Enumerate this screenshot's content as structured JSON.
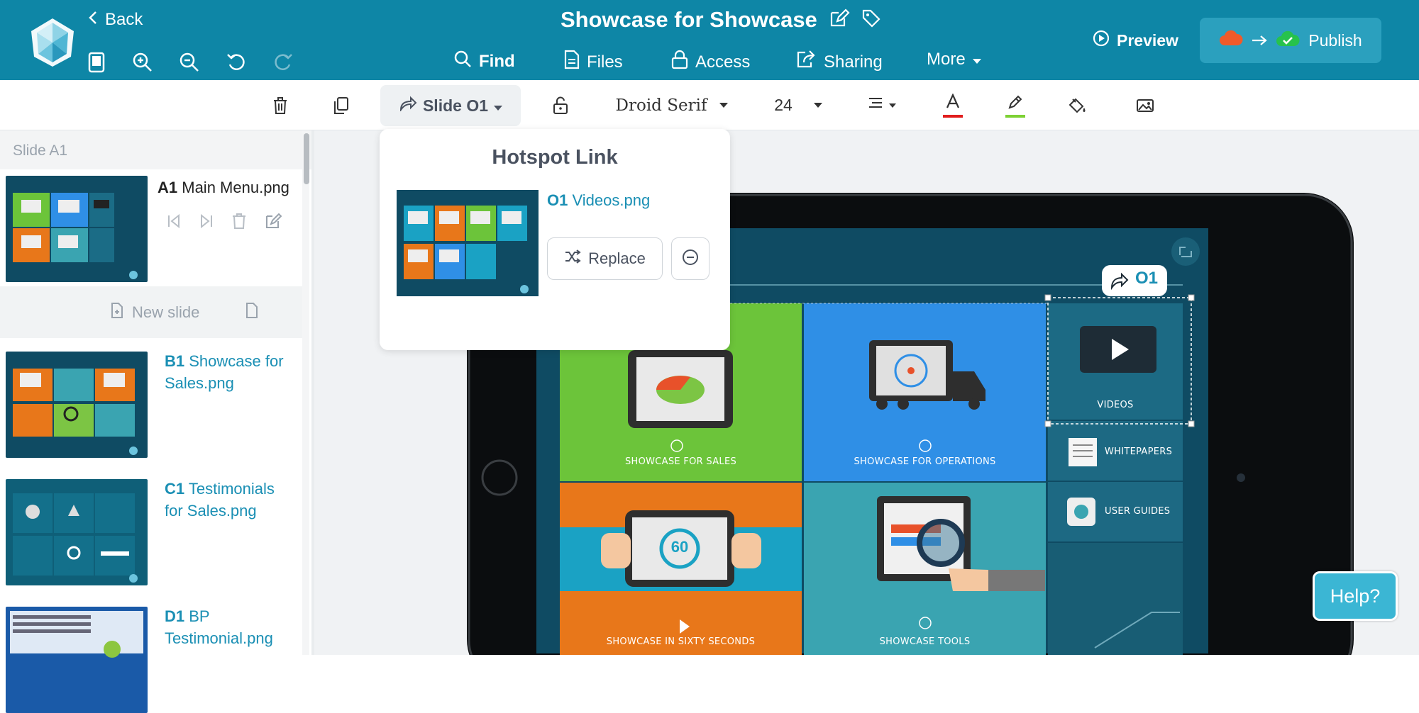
{
  "header": {
    "back_label": "Back",
    "title": "Showcase for Showcase",
    "nav": {
      "find": "Find",
      "files": "Files",
      "access": "Access",
      "sharing": "Sharing",
      "more": "More"
    },
    "preview": "Preview",
    "publish": "Publish"
  },
  "toolbar": {
    "slide_button": "Slide O1",
    "font": "Droid Serif",
    "font_size": "24",
    "text_color": "#e11d1d",
    "highlight_color": "#7dd134"
  },
  "popup": {
    "title": "Hotspot Link",
    "target_code": "O1",
    "target_name": "Videos.png",
    "replace_label": "Replace"
  },
  "sidebar": {
    "header": "Slide A1",
    "current": {
      "code": "A1",
      "name": "Main Menu.png"
    },
    "new_slide_label": "New slide",
    "slides": [
      {
        "code": "B1",
        "name": "Showcase for",
        "name2": "Sales.png"
      },
      {
        "code": "C1",
        "name": "Testimonials",
        "name2": "for Sales.png"
      },
      {
        "code": "D1",
        "name": "BP",
        "name2": "Testimonial.png"
      }
    ]
  },
  "canvas": {
    "hotspot_tag": "O1",
    "tiles": {
      "sales": "SHOWCASE FOR SALES",
      "operations": "SHOWCASE FOR OPERATIONS",
      "videos": "VIDEOS",
      "whitepapers": "WHITEPAPERS",
      "guides": "USER GUIDES",
      "sixty": "SHOWCASE IN SIXTY SECONDS",
      "tools": "SHOWCASE TOOLS",
      "sixty_badge": "60"
    }
  },
  "help_label": "Help?",
  "colors": {
    "brand": "#0e86a6",
    "accent": "#1a8fb4",
    "help": "#3bb6d4"
  }
}
